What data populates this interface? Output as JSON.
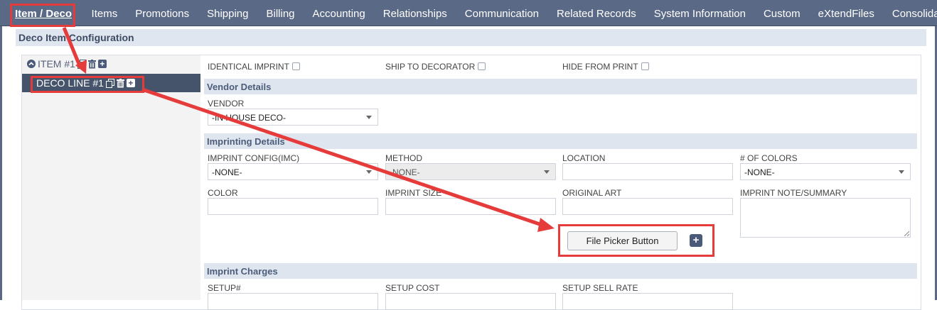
{
  "tabs": [
    {
      "label": "Item / Deco",
      "u": "I",
      "rest": "tem / Deco",
      "active": true
    },
    {
      "label": "Items",
      "u": "I",
      "rest": "tems"
    },
    {
      "label": "Promotions",
      "u": "P",
      "rest": "romotions"
    },
    {
      "label": "Shipping",
      "u": "S",
      "rest": "hipping"
    },
    {
      "label": "Billing",
      "u": "B",
      "rest": "illing"
    },
    {
      "label": "Accounting",
      "u": "A",
      "rest": "ccounting"
    },
    {
      "label": "Relationships",
      "u": "R",
      "rest": "elationships"
    },
    {
      "label": "Communication",
      "u": "C",
      "rest": "ommunication"
    },
    {
      "label": "Related Records",
      "u": "",
      "pre": "Re",
      "u2": "l",
      "rest": "ated Records"
    },
    {
      "label": "System Information",
      "u": "",
      "pre": "S",
      "u2": "y",
      "rest": "stem Information"
    },
    {
      "label": "Custom",
      "u": "",
      "pre": "C",
      "u2": "u",
      "rest": "stom"
    },
    {
      "label": "eXtendFiles",
      "u": "",
      "pre": "e",
      "u2": "X",
      "rest": "tendFiles"
    },
    {
      "label": "Consolida",
      "u": "",
      "pre": "Consolid",
      "u2": "a",
      "rest": ""
    }
  ],
  "section_title": "Deco Item Configuration",
  "tree": {
    "item_label": "ITEM #1",
    "deco_line_label": "DECO LINE #1"
  },
  "checkboxes": {
    "identical_imprint": "IDENTICAL IMPRINT",
    "ship_to_decorator": "SHIP TO DECORATOR",
    "hide_from_print": "HIDE FROM PRINT"
  },
  "vendor_details": {
    "heading": "Vendor Details",
    "vendor_label": "VENDOR",
    "vendor_value": "-IN HOUSE DECO-"
  },
  "imprinting_details": {
    "heading": "Imprinting Details",
    "imprint_config_label": "IMPRINT CONFIG(IMC)",
    "imprint_config_value": "-NONE-",
    "method_label": "METHOD",
    "method_value": "-NONE-",
    "location_label": "LOCATION",
    "num_colors_label": "# OF COLORS",
    "num_colors_value": "-NONE-",
    "color_label": "COLOR",
    "imprint_size_label": "IMPRINT SIZE",
    "original_art_label": "ORIGINAL ART",
    "imprint_note_label": "IMPRINT NOTE/SUMMARY",
    "file_picker_label": "File Picker Button",
    "file_picker_plus": "+"
  },
  "imprint_charges": {
    "heading": "Imprint Charges",
    "setup_num_label": "SETUP#",
    "setup_cost_label": "SETUP COST",
    "setup_sell_rate_label": "SETUP SELL RATE"
  },
  "colors": {
    "tabbar": "#5a6985",
    "annotation_red": "#e53b3b",
    "tree_selected": "#45536b"
  }
}
